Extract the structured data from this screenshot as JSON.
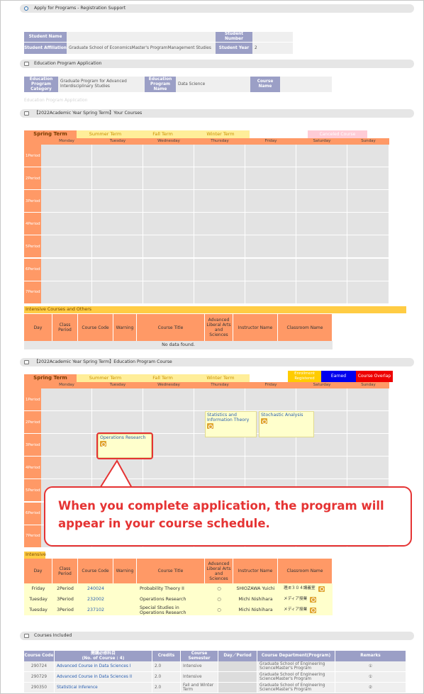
{
  "header": {
    "title": "Apply for Programs - Registration Support"
  },
  "student": {
    "name_label": "Student Name",
    "name_value": "",
    "number_label": "Student Number",
    "number_value": "",
    "affiliation_label": "Student Affiliation",
    "affiliation_value": "Graduate School of EconomicsMaster's ProgramManagement Studies",
    "year_label": "Student Year",
    "year_value": "2"
  },
  "education_section": {
    "title": "Education Program Application"
  },
  "education_info": {
    "category_label": "Education Program Category",
    "category_value": "Graduate Program for Advanced Interdisciplinary Studies",
    "program_label": "Education Program Name",
    "program_value": "Data Science",
    "course_label": "Course Name",
    "course_value": ""
  },
  "apply_link": "Education Program Application",
  "your_courses": {
    "title": "【2022Academic Year Spring Term】Your Courses"
  },
  "terms": [
    "Spring Term",
    "Summer Term",
    "Fall Term",
    "Winter Term"
  ],
  "canceled_label": "Canceled Course",
  "days": [
    "Monday",
    "Tuesday",
    "Wednesday",
    "Thursday",
    "Friday",
    "Saturday",
    "Sunday"
  ],
  "periods": [
    "1Period",
    "2Period",
    "3Period",
    "4Period",
    "5Period",
    "6Period",
    "7Period"
  ],
  "intensive": {
    "title": "Intensive Courses and Others",
    "columns": [
      "Day",
      "Class Period",
      "Course Code",
      "Warning",
      "Course Title",
      "Advanced Liberal Arts and Sciences",
      "Instructor Name",
      "Classroom Name"
    ],
    "empty": "No data found."
  },
  "edu_courses": {
    "title": "【2022Academic Year Spring Term】Education Program Course"
  },
  "legend": {
    "registered": "Enrollment Registered",
    "earned": "Earned",
    "overlap": "Course Overlap"
  },
  "schedule_courses": {
    "stats": "Statistics and Information Theory",
    "stochastic": "Stochastic Analysis",
    "or": "Operations Research"
  },
  "intensive2": {
    "title": "Intensive",
    "rows": [
      {
        "day": "Friday",
        "period": "2Period",
        "code": "240024",
        "warning": "",
        "title": "Probability Theory II",
        "liberal": "○",
        "instructor": "SHIOZAWA Yuichi",
        "room": "理/E３０４講義室"
      },
      {
        "day": "Tuesday",
        "period": "3Period",
        "code": "232002",
        "warning": "",
        "title": "Operations Research",
        "liberal": "○",
        "instructor": "Michi Nishihara",
        "room": "メディア授業"
      },
      {
        "day": "Tuesday",
        "period": "3Period",
        "code": "237102",
        "warning": "",
        "title": "Special Studies in Operations Research",
        "liberal": "○",
        "instructor": "Michi Nishihara",
        "room": "メディア授業"
      }
    ]
  },
  "callout": {
    "text": "When you complete application, the program will appear in your course schedule."
  },
  "included": {
    "title": "Courses Included",
    "columns": [
      "Course Code",
      "開講必修科目\n(No. of Course : 4)",
      "Credits",
      "Course Semester",
      "Day／Period",
      "Course Department(Program)",
      "Remarks"
    ],
    "rows": [
      {
        "code": "290724",
        "name": "Advanced Course in Data Sciences I",
        "credits": "2.0",
        "semester": "Intensive",
        "day": "",
        "dept": "Graduate School of Engineering ScienceMaster's Program",
        "remarks": "①"
      },
      {
        "code": "290729",
        "name": "Advanced Course in Data Sciences II",
        "credits": "2.0",
        "semester": "Intensive",
        "day": "",
        "dept": "Graduate School of Engineering ScienceMaster's Program",
        "remarks": "①"
      },
      {
        "code": "290350",
        "name": "Statistical Inference",
        "credits": "2.0",
        "semester": "Fall and Winter Term",
        "day": "",
        "dept": "Graduate School of Engineering ScienceMaster's Program",
        "remarks": "②"
      }
    ]
  },
  "colors": {
    "orange": "#ff9966",
    "lavender": "#9b9fc6",
    "yellow": "#ffcc44",
    "callout_red": "#e53333",
    "course_bg": "#ffffcc"
  }
}
